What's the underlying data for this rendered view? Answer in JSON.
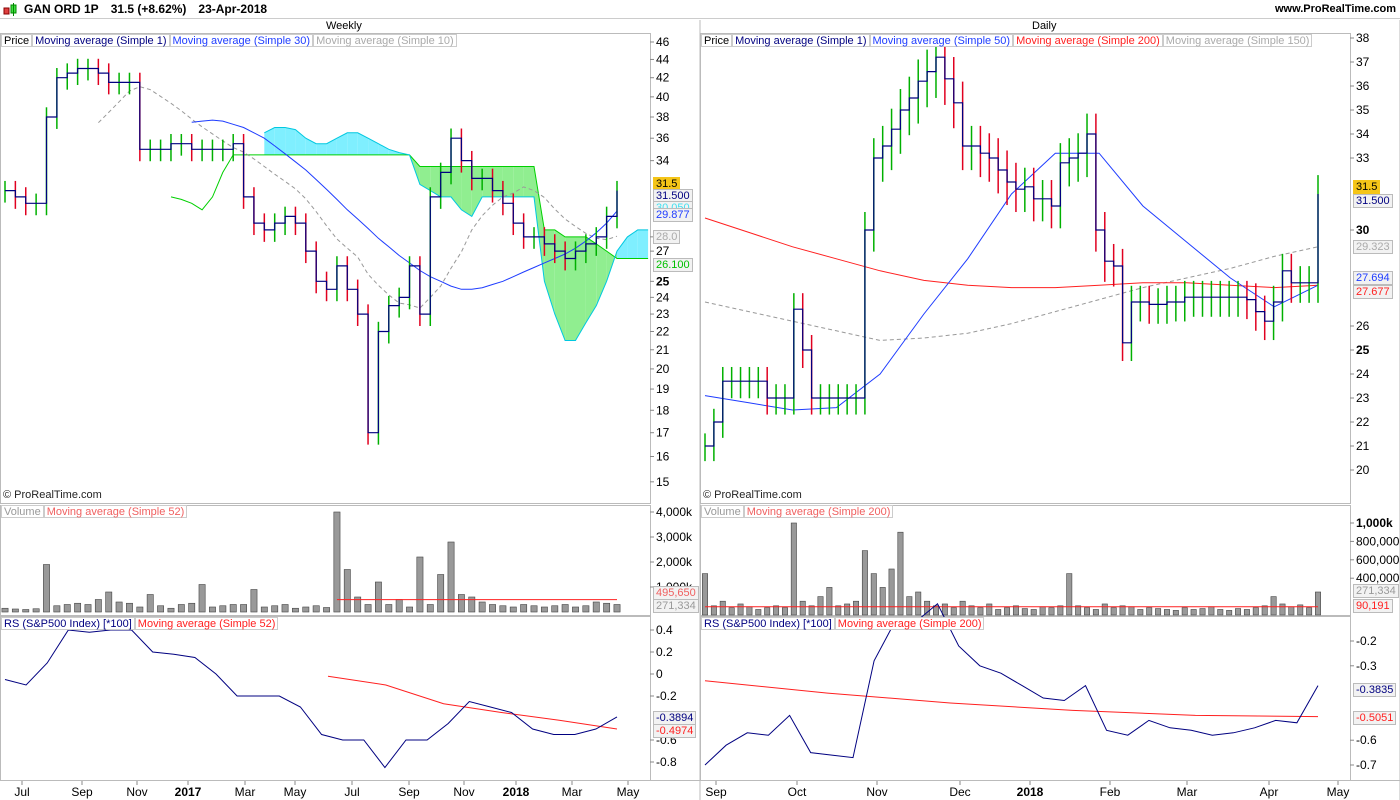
{
  "header": {
    "symbol": "GAN ORD 1P",
    "quote": "31.5 (+8.62%)",
    "date": "23-Apr-2018",
    "site": "www.ProRealTime.com"
  },
  "panels": {
    "weekly": {
      "title": "Weekly",
      "price_legend": [
        "Price",
        "Moving average (Simple 1)",
        "Moving average (Simple 30)",
        "Moving average (Simple 10)"
      ],
      "volume_legend": [
        "Volume",
        "Moving average (Simple 52)"
      ],
      "rs_legend": [
        "RS (S&P500 Index) [*100]",
        "Moving average (Simple 52)"
      ],
      "copyright": "© ProRealTime.com",
      "price_labels": {
        "last": "31.5",
        "ma1": "31.500",
        "cloud_a": "30.050",
        "ma30": "29.877",
        "ma10": "28.0",
        "span": "26.100"
      },
      "volume_labels": {
        "ma": "495,650",
        "vol": "271,334"
      },
      "rs_labels": {
        "rs": "-0.3894",
        "ma": "-0.4974"
      }
    },
    "daily": {
      "title": "Daily",
      "price_legend": [
        "Price",
        "Moving average (Simple 1)",
        "Moving average (Simple 50)",
        "Moving average (Simple 200)",
        "Moving average (Simple 150)"
      ],
      "volume_legend": [
        "Volume",
        "Moving average (Simple 200)"
      ],
      "rs_legend": [
        "RS (S&P500 Index) [*100]",
        "Moving average (Simple 200)"
      ],
      "copyright": "© ProRealTime.com",
      "price_labels": {
        "last": "31.5",
        "ma1": "31.500",
        "ma150": "29.323",
        "ma50": "27.694",
        "ma200": "27.677"
      },
      "volume_labels": {
        "vol": "271,334",
        "ma": "90,191"
      },
      "rs_labels": {
        "rs": "-0.3835",
        "ma": "-0.5051"
      }
    }
  },
  "colors": {
    "up": "#00b000",
    "down": "#e00020",
    "ma1": "#000080",
    "ma_blue": "#1e3cff",
    "ma_red": "#ff2020",
    "ma_gray": "#999999",
    "cloud_up": "#90ee90",
    "cloud_down": "#7fefff",
    "highlight": "#f5c518"
  },
  "chart_data": [
    {
      "type": "bar",
      "name": "weekly",
      "price_ticks": [
        46,
        44,
        42,
        40,
        38,
        36,
        34,
        28,
        27,
        25,
        24,
        23,
        22,
        21,
        20,
        19,
        18,
        17,
        16,
        15
      ],
      "x_ticks": [
        "Jul",
        "Sep",
        "Nov",
        "2017",
        "Mar",
        "May",
        "Jul",
        "Sep",
        "Nov",
        "2018",
        "Mar",
        "May"
      ],
      "closes": [
        31.5,
        31,
        30.5,
        30.5,
        38,
        42,
        42.5,
        43,
        43,
        42.5,
        41.5,
        41.5,
        41.5,
        35,
        35,
        35,
        35.5,
        35.5,
        35,
        35,
        35,
        35,
        35.5,
        31,
        29,
        28.5,
        29,
        29.5,
        29,
        27,
        25,
        24.5,
        26,
        24.5,
        23,
        17,
        22,
        23.5,
        24,
        26,
        23,
        31,
        33,
        36,
        34,
        32.5,
        32.5,
        31.5,
        30.5,
        29,
        28,
        28,
        27.5,
        27,
        26.5,
        27,
        27.5,
        28,
        29.5,
        31.5
      ],
      "ma10_period": 10,
      "ma30": {
        "start": 18,
        "values": [
          37.5,
          37.6,
          37.7,
          37.6,
          37.3,
          37,
          36.5,
          36,
          35.3,
          34.6,
          33.9,
          33.2,
          32.4,
          31.6,
          30.8,
          30,
          29.3,
          28.6,
          27.9,
          27.3,
          26.7,
          26.2,
          25.7,
          25.3,
          25,
          24.7,
          24.5,
          24.5,
          24.6,
          24.8,
          25,
          25.3,
          25.6,
          25.9,
          26.2,
          26.5,
          26.8,
          27.2,
          27.7,
          28.3,
          29,
          29.9
        ]
      },
      "cloud": {
        "span_a_start": 16,
        "span_a": [
          31,
          30.8,
          30.5,
          30,
          31,
          33,
          34.5,
          34.5,
          34.5,
          34.5,
          34.5,
          34.5,
          34.5,
          34.5,
          34.5,
          34.5,
          34.5,
          34.5,
          34.5,
          34.5,
          34.5,
          34.5,
          34.5,
          34.5,
          33.5,
          33.5,
          33.5,
          33.5,
          33.5,
          33.5,
          33.5,
          33.5,
          33.5,
          33.5,
          33.5,
          33.5,
          28.5,
          28.5,
          28,
          28,
          28,
          27.5,
          27,
          26.5,
          26.5,
          26.5,
          26.5
        ],
        "span_b_start": 25,
        "span_b": [
          36.5,
          37,
          37,
          36.8,
          36,
          35.5,
          35.5,
          36,
          36.5,
          36.5,
          36,
          35.5,
          35,
          34.7,
          34.5,
          32,
          31.5,
          31,
          31,
          30,
          29.5,
          31,
          31,
          31,
          31,
          31,
          31,
          25,
          23,
          21.5,
          21.5,
          22.5,
          23.5,
          25,
          27,
          28,
          28.5,
          28.5
        ]
      },
      "volume_ticks": [
        "4,000k",
        "3,000k",
        "2,000k",
        "1,000k"
      ],
      "volume_tick_values": [
        4000,
        3000,
        2000,
        1000
      ],
      "volume_k": [
        150,
        120,
        100,
        130,
        1900,
        250,
        300,
        350,
        300,
        500,
        800,
        400,
        350,
        200,
        700,
        250,
        150,
        300,
        350,
        1100,
        200,
        250,
        300,
        300,
        900,
        200,
        250,
        300,
        150,
        200,
        250,
        180,
        4000,
        1700,
        600,
        300,
        1200,
        300,
        500,
        200,
        2200,
        300,
        1500,
        2800,
        700,
        600,
        400,
        300,
        250,
        200,
        300,
        250,
        200,
        250,
        300,
        200,
        250,
        400,
        350,
        300
      ],
      "volume_ma_k": {
        "start": 32,
        "value": 495.65
      },
      "rs_ticks": [
        0.4,
        0.2,
        0,
        -0.2,
        -0.6,
        -0.8
      ],
      "rs": [
        -0.05,
        -0.1,
        0.1,
        0.4,
        0.38,
        0.4,
        0.4,
        0.2,
        0.18,
        0.15,
        0,
        -0.2,
        -0.2,
        -0.2,
        -0.3,
        -0.55,
        -0.6,
        -0.6,
        -0.85,
        -0.6,
        -0.6,
        -0.45,
        -0.25,
        -0.3,
        -0.35,
        -0.5,
        -0.55,
        -0.55,
        -0.5,
        -0.39
      ],
      "rs_ma": [
        -0.02,
        -0.1,
        -0.27,
        -0.35,
        -0.42,
        -0.5
      ]
    },
    {
      "type": "bar",
      "name": "daily",
      "price_ticks": [
        38,
        37,
        36,
        35,
        34,
        33,
        30,
        26,
        25,
        24,
        23,
        22,
        21,
        20
      ],
      "x_ticks": [
        "Sep",
        "Oct",
        "Nov",
        "Dec",
        "2018",
        "Feb",
        "Mar",
        "Apr",
        "May"
      ],
      "closes": [
        21,
        22,
        23.7,
        23.7,
        23.7,
        23.7,
        23.7,
        23,
        23,
        23,
        26.7,
        25,
        23,
        23,
        23,
        23,
        23,
        23,
        30,
        33,
        33.5,
        34.2,
        35,
        35.5,
        36.2,
        36.6,
        37.2,
        36.3,
        35.3,
        33.5,
        33.5,
        33.2,
        33,
        32.5,
        32,
        31.7,
        31.8,
        31.3,
        31.3,
        31,
        32.8,
        33,
        33.2,
        34,
        30,
        28.7,
        28.5,
        25.3,
        27,
        27,
        26.9,
        26.9,
        27,
        27,
        27.2,
        27.2,
        27.2,
        27.2,
        27.2,
        27.2,
        27.2,
        27.1,
        26.6,
        26.2,
        27,
        28.3,
        27.8,
        27.8,
        27.8,
        31.5
      ],
      "ma50": [
        23.1,
        22.8,
        22.5,
        22.6,
        24,
        26.5,
        28.8,
        31.5,
        33.2,
        33.2,
        31,
        29.5,
        28,
        26.8,
        27.7
      ],
      "ma200": [
        30.5,
        29.9,
        29.3,
        28.8,
        28.3,
        27.9,
        27.7,
        27.6,
        27.6,
        27.7,
        27.8,
        27.8,
        27.7,
        27.6,
        27.7
      ],
      "ma150": [
        27,
        26.6,
        26.2,
        25.8,
        25.4,
        25.5,
        25.7,
        26.1,
        26.6,
        27.1,
        27.6,
        28,
        28.4,
        28.9,
        29.3
      ],
      "volume_ticks": [
        "1,000k",
        "800,000",
        "600,000",
        "400,000"
      ],
      "volume_tick_values": [
        1000,
        800,
        600,
        400
      ],
      "volume_k": [
        450,
        100,
        150,
        80,
        120,
        90,
        60,
        80,
        100,
        80,
        1000,
        150,
        100,
        200,
        300,
        100,
        120,
        150,
        700,
        450,
        300,
        500,
        900,
        200,
        250,
        150,
        100,
        120,
        80,
        150,
        100,
        80,
        120,
        60,
        80,
        100,
        70,
        60,
        90,
        80,
        100,
        450,
        100,
        80,
        60,
        120,
        80,
        100,
        90,
        60,
        80,
        70,
        60,
        50,
        80,
        60,
        70,
        90,
        60,
        50,
        70,
        60,
        80,
        100,
        200,
        120,
        90,
        110,
        80,
        250
      ],
      "volume_ma_k": {
        "start": 0,
        "value": 90.191
      },
      "rs_ticks": [
        -0.2,
        -0.3,
        -0.6,
        -0.7
      ],
      "rs": [
        -0.7,
        -0.62,
        -0.57,
        -0.58,
        -0.5,
        -0.65,
        -0.66,
        -0.67,
        -0.28,
        -0.12,
        -0.12,
        -0.05,
        -0.22,
        -0.3,
        -0.33,
        -0.38,
        -0.43,
        -0.44,
        -0.38,
        -0.56,
        -0.58,
        -0.52,
        -0.55,
        -0.56,
        -0.58,
        -0.57,
        -0.55,
        -0.52,
        -0.53,
        -0.38
      ],
      "rs_ma": [
        -0.36,
        -0.41,
        -0.45,
        -0.48,
        -0.5,
        -0.505
      ]
    }
  ]
}
